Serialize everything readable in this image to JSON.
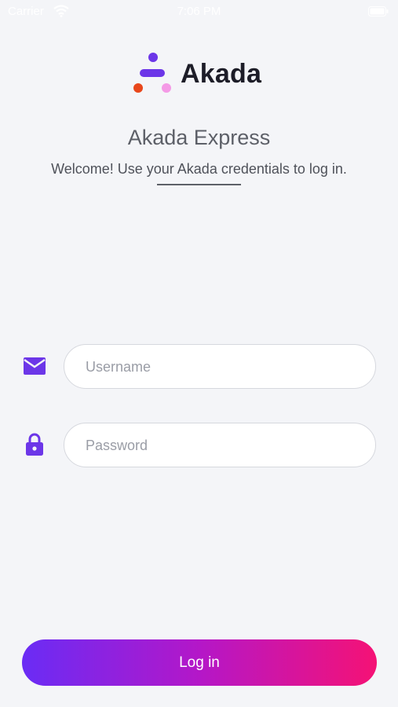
{
  "status_bar": {
    "carrier": "Carrier",
    "time": "7:06 PM"
  },
  "brand": {
    "name": "Akada",
    "logo_icon": "akada-logo-icon",
    "colors": {
      "purple": "#6c36e8",
      "orange": "#e8471b",
      "pink": "#f49ae6"
    }
  },
  "app_title": "Akada Express",
  "welcome_text": "Welcome!  Use your Akada credentials to log in.",
  "form": {
    "username": {
      "placeholder": "Username",
      "value": "",
      "icon": "envelope-icon"
    },
    "password": {
      "placeholder": "Password",
      "value": "",
      "icon": "lock-icon"
    }
  },
  "login_button": {
    "label": "Log in",
    "gradient": [
      "#6a2cf5",
      "#b417c8",
      "#f51275"
    ]
  },
  "accent_color": "#6c36e8"
}
